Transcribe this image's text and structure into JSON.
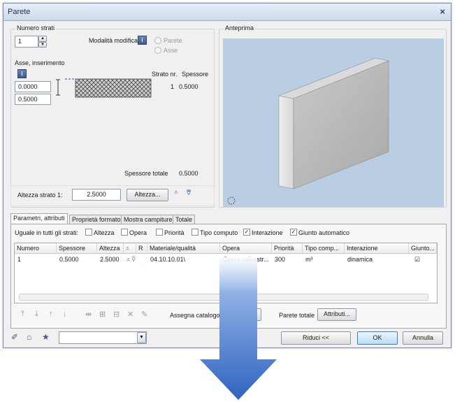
{
  "window": {
    "title": "Parete",
    "close": "×"
  },
  "layers": {
    "label": "Numero strati",
    "count": "1"
  },
  "edit_mode": {
    "label": "Modalità modifica",
    "options": [
      "Parete",
      "Asse"
    ]
  },
  "axis": {
    "label": "Asse, inserimento",
    "value1": "0.0000",
    "value2": "0.5000"
  },
  "layer_table": {
    "col_nr": "Strato nr.",
    "col_thick": "Spessore",
    "nr": "1",
    "thickness": "0.5000"
  },
  "total": {
    "label": "Spessore totale",
    "value": "0.5000"
  },
  "height": {
    "label": "Altezza strato 1:",
    "value": "2.5000",
    "button": "Altezza..."
  },
  "preview": {
    "label": "Anteprima"
  },
  "tabs": [
    "Parametri, attributi",
    "Proprietà formato",
    "Mostra campiture",
    "Totale"
  ],
  "uniform": {
    "label": "Uguale in tutti gli strati:",
    "items": [
      {
        "label": "Altezza",
        "checked": false
      },
      {
        "label": "Opera",
        "checked": false
      },
      {
        "label": "Priorità",
        "checked": false
      },
      {
        "label": "Tipo computo",
        "checked": false
      },
      {
        "label": "Interazione",
        "checked": true
      },
      {
        "label": "Giunto automatico",
        "checked": true
      }
    ]
  },
  "grid": {
    "headers": [
      "Numero",
      "Spessore",
      "Altezza",
      "R",
      "Materiale/qualità",
      "Opera",
      "Priorità",
      "Tipo comp...",
      "Interazione",
      "Giunto..."
    ],
    "row": [
      "1",
      "0.5000",
      "2.5000",
      "04.10.10.01\\",
      "Opere calcestr...",
      "300",
      "m³",
      "dinamica",
      "☑"
    ]
  },
  "bottom": {
    "assign_label": "Assegna catalogo",
    "wall_total": "Parete totale",
    "attributes_button": "Attributi...",
    "reduce_button": "Riduci <<",
    "ok_button": "OK",
    "cancel_button": "Annulla"
  },
  "colors": {
    "preview_bg": "#b9cde3",
    "arrow": "#3f73c8",
    "title_text": "#1e2d4a"
  }
}
